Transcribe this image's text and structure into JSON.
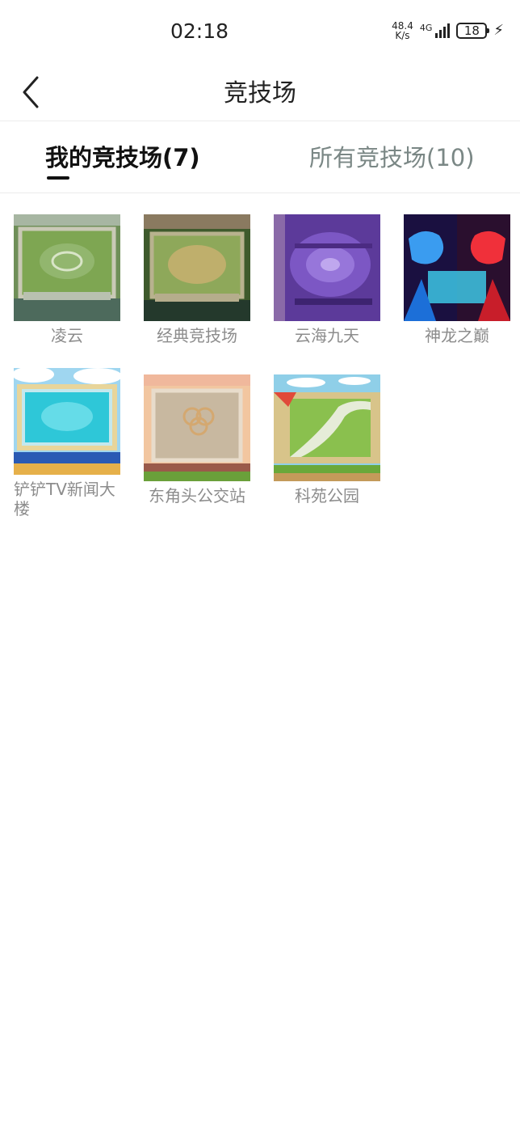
{
  "status_bar": {
    "time": "02:18",
    "net_speed_value": "48.4",
    "net_speed_unit": "K/s",
    "network_type": "4G",
    "battery": "18"
  },
  "header": {
    "title": "竞技场"
  },
  "tabs": [
    {
      "label": "我的竞技场(7)",
      "active": true
    },
    {
      "label": "所有竞技场(10)",
      "active": false
    }
  ],
  "arenas": [
    {
      "name": "凌云"
    },
    {
      "name": "经典竞技场"
    },
    {
      "name": "云海九天"
    },
    {
      "name": "神龙之巅"
    },
    {
      "name": "铲铲TV新闻大楼"
    },
    {
      "name": "东角头公交站"
    },
    {
      "name": "科苑公园"
    }
  ]
}
